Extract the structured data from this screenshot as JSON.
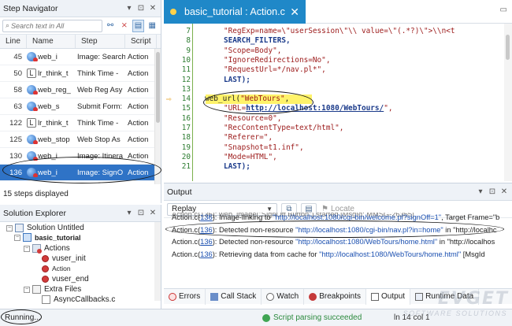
{
  "step_navigator": {
    "title": "Step Navigator",
    "search_placeholder": "Search text in All",
    "columns": [
      "Line",
      "Name",
      "Step",
      "Script"
    ],
    "rows": [
      {
        "line": "45",
        "name": "web_i",
        "step": "Image: Search",
        "script": "Action",
        "icon": "web-image-icon"
      },
      {
        "line": "50",
        "name": "lr_think_t",
        "step": "Think Time -",
        "script": "Action",
        "icon": "think-time-icon"
      },
      {
        "line": "58",
        "name": "web_reg_",
        "step": "Web Reg Asy",
        "script": "Action",
        "icon": "web-reg-icon"
      },
      {
        "line": "63",
        "name": "web_s",
        "step": "Submit Form:",
        "script": "Action",
        "icon": "web-submit-icon"
      },
      {
        "line": "122",
        "name": "lr_think_t",
        "step": "Think Time -",
        "script": "Action",
        "icon": "think-time-icon"
      },
      {
        "line": "125",
        "name": "web_stop",
        "step": "Web Stop As",
        "script": "Action",
        "icon": "web-stop-icon"
      },
      {
        "line": "130",
        "name": "web_i",
        "step": "Image: Itinera",
        "script": "Action",
        "icon": "web-image-icon"
      },
      {
        "line": "136",
        "name": "web_i",
        "step": "Image: SignO",
        "script": "Action",
        "icon": "web-image-icon",
        "selected": true
      }
    ],
    "footer": "15 steps displayed"
  },
  "solution_explorer": {
    "title": "Solution Explorer",
    "items": {
      "solution": "Solution Untitled",
      "script": "basic_tutorial",
      "actions": "Actions",
      "vuser_init": "vuser_init",
      "action": "Action",
      "vuser_end": "vuser_end",
      "extra_files": "Extra Files",
      "async": "AsyncCallbacks.c"
    }
  },
  "editor": {
    "tab_title": "basic_tutorial : Action.c",
    "lines": [
      {
        "n": "7",
        "text": "\"RegExp=name=\\\"userSession\\\"\\\\ value=\\\"(.*?)\\\">\\\\n<t"
      },
      {
        "n": "8",
        "text": "SEARCH_FILTERS,"
      },
      {
        "n": "9",
        "text": "\"Scope=Body\","
      },
      {
        "n": "10",
        "text": "\"IgnoreRedirections=No\","
      },
      {
        "n": "11",
        "text": "\"RequestUrl=*/nav.pl*\","
      },
      {
        "n": "12",
        "text": "LAST);"
      },
      {
        "n": "13",
        "text": ""
      },
      {
        "n": "14",
        "text": "web_url(\"WebTours\","
      },
      {
        "n": "15",
        "text": "\"URL=http://localhost:1080/WebTours/\","
      },
      {
        "n": "16",
        "text": "\"Resource=0\","
      },
      {
        "n": "17",
        "text": "\"RecContentType=text/html\","
      },
      {
        "n": "18",
        "text": "\"Referer=\","
      },
      {
        "n": "19",
        "text": "\"Snapshot=t1.inf\","
      },
      {
        "n": "20",
        "text": "\"Mode=HTML\","
      },
      {
        "n": "21",
        "text": "LAST);"
      }
    ]
  },
  "output": {
    "title": "Output",
    "dropdown_value": "Replay",
    "locate_label": "Locate",
    "lines": [
      {
        "prefix": "Action.c(",
        "ref": "136",
        "text": "): Image-linking to ",
        "quoted": "\"http://localhost:1080/cgi-bin/welcome.pl?signOff=1\"",
        "suffix": ", Target Frame=\"b"
      },
      {
        "prefix": "Action.c(",
        "ref": "136",
        "text": "): Detected non-resource ",
        "quoted": "\"http://localhost:1080/cgi-bin/nav.pl?in=home\"",
        "suffix": " in \"http://localhc"
      },
      {
        "prefix": "Action.c(",
        "ref": "136",
        "text": "): Detected non-resource ",
        "quoted": "\"http://localhost:1080/WebTours/home.html\"",
        "suffix": " in \"http://localhos"
      },
      {
        "prefix": "Action.c(",
        "ref": "136",
        "text": "): Retrieving data from cache for ",
        "quoted": "\"http://localhost:1080/WebTours/home.html\"",
        "suffix": "     [MsgId"
      }
    ],
    "partial_top_line": "Action.c(136): web_image(\"SignOff Button\") started    [MsgId: MMSG-26355]",
    "tabs": [
      "Errors",
      "Call Stack",
      "Watch",
      "Breakpoints",
      "Output",
      "Runtime Data"
    ],
    "active_tab": "Output"
  },
  "statusbar": {
    "left": "Running...",
    "message": "Script parsing succeeded",
    "position": "ln 14     col 1"
  },
  "watermark": {
    "main": "EVGET",
    "sub": "SOFTWARE SOLUTIONS"
  }
}
